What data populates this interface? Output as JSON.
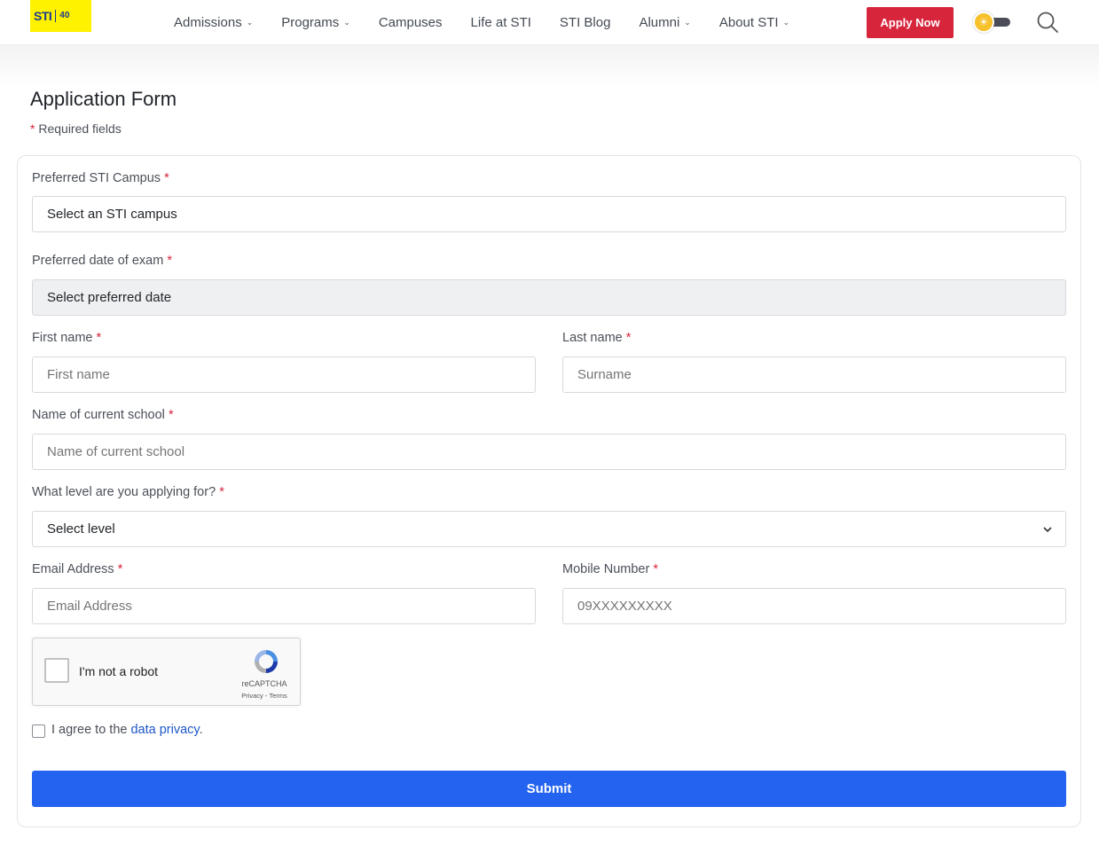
{
  "header": {
    "logo_text": "STI",
    "logo_badge": "40",
    "nav": [
      {
        "label": "Admissions",
        "has_dropdown": true
      },
      {
        "label": "Programs",
        "has_dropdown": true
      },
      {
        "label": "Campuses",
        "has_dropdown": false
      },
      {
        "label": "Life at STI",
        "has_dropdown": false
      },
      {
        "label": "STI Blog",
        "has_dropdown": false
      },
      {
        "label": "Alumni",
        "has_dropdown": true
      },
      {
        "label": "About STI",
        "has_dropdown": true
      }
    ],
    "apply_label": "Apply Now",
    "theme_toggle_icon": "sun-icon",
    "search_icon": "search-icon",
    "colors": {
      "logo_bg": "#fff200",
      "apply_bg": "#d7253c"
    }
  },
  "page": {
    "title": "Application Form",
    "required_star": "*",
    "required_note": "Required fields"
  },
  "form": {
    "campus": {
      "label": "Preferred STI Campus",
      "value": "Select an STI campus"
    },
    "exam_date": {
      "label": "Preferred date of exam",
      "value": "Select preferred date"
    },
    "first_name": {
      "label": "First name",
      "placeholder": "First name"
    },
    "last_name": {
      "label": "Last name",
      "placeholder": "Surname"
    },
    "school": {
      "label": "Name of current school",
      "placeholder": "Name of current school"
    },
    "level": {
      "label": "What level are you applying for?",
      "value": "Select level"
    },
    "email": {
      "label": "Email Address",
      "placeholder": "Email Address"
    },
    "mobile": {
      "label": "Mobile Number",
      "placeholder": "09XXXXXXXXX"
    },
    "recaptcha": {
      "text": "I'm not a robot",
      "brand": "reCAPTCHA",
      "links": "Privacy - Terms"
    },
    "agree": {
      "prefix": "I agree to the ",
      "link": "data privacy",
      "suffix": "."
    },
    "submit_label": "Submit",
    "colors": {
      "submit_bg": "#2363f0",
      "required": "#d7253c"
    }
  }
}
